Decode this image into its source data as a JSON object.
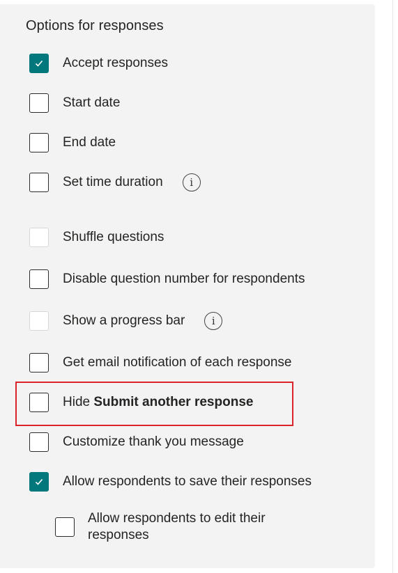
{
  "panel": {
    "title": "Options for responses"
  },
  "options": [
    {
      "label": "Accept responses",
      "checked": true,
      "disabled": false
    },
    {
      "label": "Start date",
      "checked": false,
      "disabled": false
    },
    {
      "label": "End date",
      "checked": false,
      "disabled": false
    },
    {
      "label": "Set time duration",
      "checked": false,
      "disabled": false,
      "info_icon": "info-icon"
    },
    {
      "label": "Shuffle questions",
      "checked": false,
      "disabled": true
    },
    {
      "label": "Disable question number for respondents",
      "checked": false,
      "disabled": false
    },
    {
      "label": "Show a progress bar",
      "checked": false,
      "disabled": true,
      "info_icon": "info-icon"
    },
    {
      "label": "Get email notification of each response",
      "checked": false,
      "disabled": false
    },
    {
      "label_prefix": "Hide",
      "label_bold": "Submit another response",
      "checked": false,
      "disabled": false,
      "highlighted": true
    },
    {
      "label": "Customize thank you message",
      "checked": false,
      "disabled": false
    },
    {
      "label": "Allow respondents to save their responses",
      "checked": true,
      "disabled": false
    },
    {
      "label": "Allow respondents to edit their responses",
      "checked": false,
      "disabled": false,
      "nested": true
    }
  ],
  "info_glyph": "i",
  "colors": {
    "accent": "#03787c",
    "highlight_border": "#d8232a",
    "panel_bg": "#f3f3f3"
  }
}
